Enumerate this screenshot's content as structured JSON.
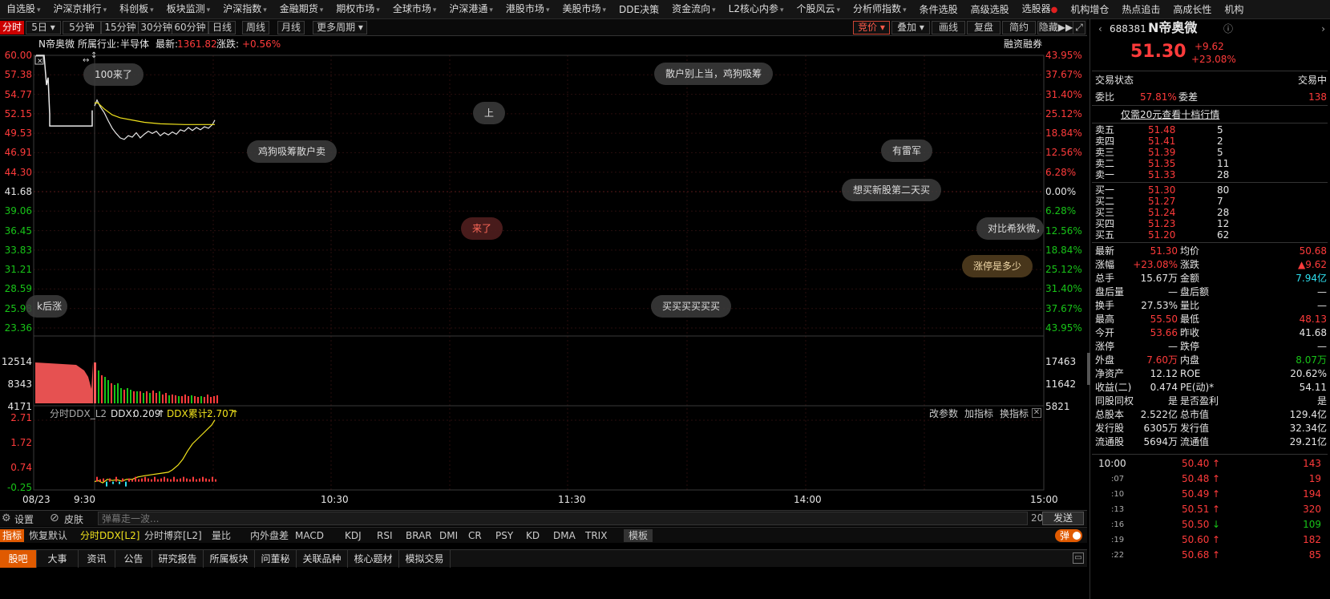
{
  "menu": {
    "items": [
      "自选股",
      "沪深京排行",
      "科创板",
      "板块监测",
      "沪深指数",
      "金融期货",
      "期权市场",
      "全球市场",
      "沪深港通",
      "港股市场",
      "美股市场",
      "DDE决策",
      "资金流向",
      "L2核心内参",
      "个股风云",
      "分析师指数",
      "条件选股",
      "高级选股",
      "选股器",
      "机构增仓",
      "热点追击",
      "高成长性",
      "机构"
    ]
  },
  "period": {
    "items": [
      "分时",
      "5日",
      "5分钟",
      "15分钟",
      "30分钟",
      "60分钟",
      "日线",
      "周线",
      "月线",
      "更多周期"
    ],
    "active": "分时"
  },
  "tools": {
    "items": [
      "竞价",
      "叠加",
      "画线",
      "复盘",
      "简约",
      "隐藏▶▶"
    ],
    "fullscreen_icon": "expand-icon"
  },
  "info": {
    "name": "N帝奥微",
    "industry_label": "所属行业:",
    "industry": "半导体",
    "latest_label": "最新:",
    "latest": "1361.82",
    "change_label": "涨跌:",
    "change": "+0.56%",
    "margin": "融资融券"
  },
  "left_axis": [
    "60.00",
    "57.38",
    "54.77",
    "52.15",
    "49.53",
    "46.91",
    "44.30",
    "41.68",
    "39.06",
    "36.45",
    "33.83",
    "31.21",
    "28.59",
    "25.98",
    "23.36"
  ],
  "right_axis": [
    "43.95%",
    "37.67%",
    "31.40%",
    "25.12%",
    "18.84%",
    "12.56%",
    "6.28%",
    "0.00%",
    "6.28%",
    "12.56%",
    "18.84%",
    "25.12%",
    "31.40%",
    "37.67%",
    "43.95%"
  ],
  "vol_axis_left": [
    "12514",
    "8343",
    "4171"
  ],
  "vol_axis_right": [
    "17463",
    "11642",
    "5821"
  ],
  "ddx": {
    "name": "分时DDX_L2",
    "ddx_label": "DDX:",
    "ddx_value": "0.209",
    "ddx_sum_label": "DDX累计:",
    "ddx_sum": "2.707",
    "axis": [
      "2.71",
      "1.72",
      "0.74",
      "-0.25"
    ],
    "params": "改参数",
    "add": "加指标",
    "swap": "换指标"
  },
  "time_axis": [
    "08/23",
    "9:30",
    "10:30",
    "11:30",
    "14:00",
    "15:00"
  ],
  "danmaku": [
    {
      "text": "100来了",
      "style": "n"
    },
    {
      "text": "散户别上当，鸡狗吸筹",
      "style": "n"
    },
    {
      "text": "上",
      "style": "n"
    },
    {
      "text": "鸡狗吸筹散户卖",
      "style": "n"
    },
    {
      "text": "有雷军",
      "style": "n"
    },
    {
      "text": "想买新股第二天买",
      "style": "n"
    },
    {
      "text": "来了",
      "style": "r"
    },
    {
      "text": "对比希狄微，",
      "style": "n"
    },
    {
      "text": "涨停是多少",
      "style": "o"
    },
    {
      "text": "k后涨",
      "style": "n"
    },
    {
      "text": "买买买买买买",
      "style": "n"
    }
  ],
  "bottom1": {
    "settings": "设置",
    "skin": "皮肤",
    "input_placeholder": "弹幕走一波...",
    "count": "20",
    "send": "发送"
  },
  "bottom2": {
    "items": [
      "指标",
      "恢复默认",
      "分时DDX[L2]",
      "分时博弈[L2]",
      "量比",
      "内外盘差",
      "MACD",
      "KDJ",
      "RSI",
      "BRAR",
      "DMI",
      "CR",
      "PSY",
      "KD",
      "DMA",
      "TRIX",
      "模板"
    ],
    "toggle": "弹"
  },
  "bottom3": {
    "items": [
      "股吧",
      "大事",
      "资讯",
      "公告",
      "研究报告",
      "所属板块",
      "问董秘",
      "关联品种",
      "核心题材",
      "模拟交易"
    ]
  },
  "stock": {
    "code": "688381",
    "name": "N帝奥微",
    "price": "51.30",
    "change": "+9.62",
    "change_pct": "+23.08%",
    "status_label": "交易状态",
    "status": "交易中",
    "weibi_label": "委比",
    "weibi": "57.81%",
    "weicha_label": "委差",
    "weicha": "138",
    "promo": "仅需20元查看十档行情"
  },
  "asks": [
    {
      "label": "卖五",
      "price": "51.48",
      "vol": "5"
    },
    {
      "label": "卖四",
      "price": "51.41",
      "vol": "2"
    },
    {
      "label": "卖三",
      "price": "51.39",
      "vol": "5"
    },
    {
      "label": "卖二",
      "price": "51.35",
      "vol": "11"
    },
    {
      "label": "卖一",
      "price": "51.33",
      "vol": "28"
    }
  ],
  "bids": [
    {
      "label": "买一",
      "price": "51.30",
      "vol": "80"
    },
    {
      "label": "买二",
      "price": "51.27",
      "vol": "7"
    },
    {
      "label": "买三",
      "price": "51.24",
      "vol": "28"
    },
    {
      "label": "买四",
      "price": "51.23",
      "vol": "12"
    },
    {
      "label": "买五",
      "price": "51.20",
      "vol": "62"
    }
  ],
  "stats": [
    {
      "l1": "最新",
      "v1": "51.30",
      "c1": "red",
      "l2": "均价",
      "v2": "50.68",
      "c2": "red"
    },
    {
      "l1": "涨幅",
      "v1": "+23.08%",
      "c1": "red",
      "l2": "涨跌",
      "v2": "▲9.62",
      "c2": "red"
    },
    {
      "l1": "总手",
      "v1": "15.67万",
      "c1": "wht",
      "l2": "金额",
      "v2": "7.94亿",
      "c2": "cyn"
    },
    {
      "l1": "盘后量",
      "v1": "—",
      "c1": "wht",
      "l2": "盘后额",
      "v2": "—",
      "c2": "wht"
    },
    {
      "l1": "换手",
      "v1": "27.53%",
      "c1": "wht",
      "l2": "量比",
      "v2": "—",
      "c2": "wht"
    },
    {
      "l1": "最高",
      "v1": "55.50",
      "c1": "red",
      "l2": "最低",
      "v2": "48.13",
      "c2": "red"
    },
    {
      "l1": "今开",
      "v1": "53.66",
      "c1": "red",
      "l2": "昨收",
      "v2": "41.68",
      "c2": "wht"
    },
    {
      "l1": "涨停",
      "v1": "—",
      "c1": "wht",
      "l2": "跌停",
      "v2": "—",
      "c2": "wht"
    },
    {
      "l1": "外盘",
      "v1": "7.60万",
      "c1": "red",
      "l2": "内盘",
      "v2": "8.07万",
      "c2": "grn"
    },
    {
      "l1": "净资产",
      "v1": "12.12",
      "c1": "wht",
      "l2": "ROE",
      "v2": "20.62%",
      "c2": "wht"
    },
    {
      "l1": "收益(二)",
      "v1": "0.474",
      "c1": "wht",
      "l2": "PE(动)*",
      "v2": "54.11",
      "c2": "wht"
    },
    {
      "l1": "同股同权",
      "v1": "是",
      "c1": "wht",
      "l2": "是否盈利",
      "v2": "是",
      "c2": "wht"
    },
    {
      "l1": "总股本",
      "v1": "2.522亿",
      "c1": "wht",
      "l2": "总市值",
      "v2": "129.4亿",
      "c2": "wht"
    },
    {
      "l1": "发行股",
      "v1": "6305万",
      "c1": "wht",
      "l2": "发行值",
      "v2": "32.34亿",
      "c2": "wht"
    },
    {
      "l1": "流通股",
      "v1": "5694万",
      "c1": "wht",
      "l2": "流通值",
      "v2": "29.21亿",
      "c2": "wht"
    }
  ],
  "ticks": [
    {
      "time": "10:00",
      "price": "50.40",
      "dir": "↑",
      "dc": "red",
      "vol": "143",
      "vc": "red"
    },
    {
      "time": ":07",
      "price": "50.48",
      "dir": "↑",
      "dc": "red",
      "vol": "19",
      "vc": "red"
    },
    {
      "time": ":10",
      "price": "50.49",
      "dir": "↑",
      "dc": "red",
      "vol": "194",
      "vc": "red"
    },
    {
      "time": ":13",
      "price": "50.51",
      "dir": "↑",
      "dc": "red",
      "vol": "320",
      "vc": "red"
    },
    {
      "time": ":16",
      "price": "50.50",
      "dir": "↓",
      "dc": "grn",
      "vol": "109",
      "vc": "grn"
    },
    {
      "time": ":19",
      "price": "50.60",
      "dir": "↑",
      "dc": "red",
      "vol": "182",
      "vc": "red"
    },
    {
      "time": ":22",
      "price": "50.68",
      "dir": "↑",
      "dc": "red",
      "vol": "85",
      "vc": "red"
    }
  ],
  "colors": {
    "up": "#ff3b3b",
    "down": "#18c418",
    "price_line": "#e8e8e8",
    "avg_line": "#f0e21c",
    "accent": "#e05a00"
  }
}
